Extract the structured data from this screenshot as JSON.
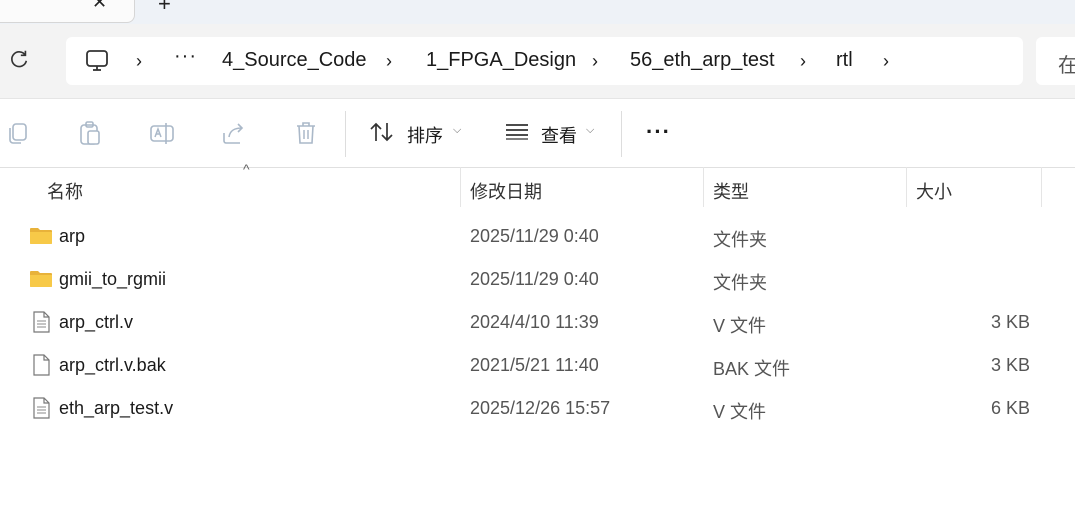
{
  "tabs": {
    "close_glyph": "✕",
    "new_tab_glyph": "+"
  },
  "address_bar": {
    "crumbs": [
      "4_Source_Code",
      "1_FPGA_Design",
      "56_eth_arp_test",
      "rtl"
    ],
    "overflow": "···",
    "separator": "›",
    "search_prefix": "在"
  },
  "toolbar": {
    "sort_label": "排序",
    "view_label": "查看",
    "more": "···",
    "chevron": "⌵"
  },
  "columns": {
    "name": "名称",
    "modified": "修改日期",
    "type": "类型",
    "size": "大小"
  },
  "files": [
    {
      "name": "arp",
      "modified": "2025/11/29 0:40",
      "type": "文件夹",
      "size": "",
      "icon": "folder-icon"
    },
    {
      "name": "gmii_to_rgmii",
      "modified": "2025/11/29 0:40",
      "type": "文件夹",
      "size": "",
      "icon": "folder-icon"
    },
    {
      "name": "arp_ctrl.v",
      "modified": "2024/4/10 11:39",
      "type": "V 文件",
      "size": "3 KB",
      "icon": "text-file-icon"
    },
    {
      "name": "arp_ctrl.v.bak",
      "modified": "2021/5/21 11:40",
      "type": "BAK 文件",
      "size": "3 KB",
      "icon": "blank-file-icon"
    },
    {
      "name": "eth_arp_test.v",
      "modified": "2025/12/26 15:57",
      "type": "V 文件",
      "size": "6 KB",
      "icon": "text-file-icon"
    }
  ],
  "colors": {
    "folder": "#f7c948",
    "folder_dark": "#e8b23a",
    "accent": "#0067c0"
  }
}
